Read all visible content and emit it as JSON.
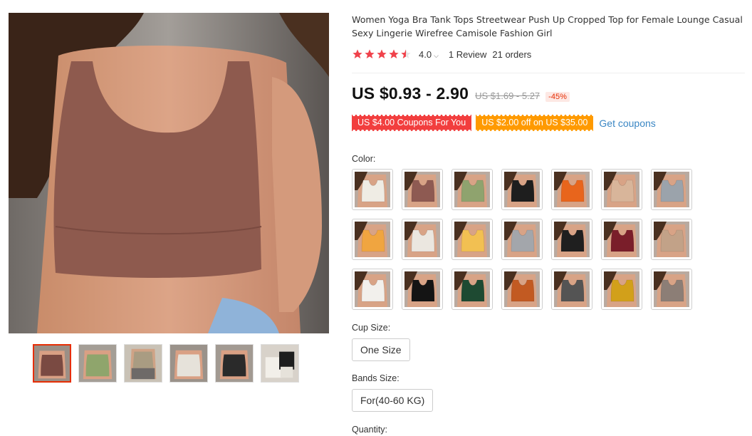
{
  "product": {
    "title": "Women Yoga Bra Tank Tops Streetwear Push Up Cropped Top for Female Lounge Casual Sexy Lingerie Wirefree Camisole Fashion Girl",
    "rating": "4.0",
    "rating_stars": 4.5,
    "reviews": "1 Review",
    "orders": "21 orders",
    "price": "US $0.93 - 2.90",
    "old_price": "US $1.69 - 5.27",
    "discount": "-45%"
  },
  "coupons": {
    "coupon1": "US $4.00 Coupons For You",
    "coupon2": "US $2.00 off on US $35.00",
    "get_coupons": "Get coupons"
  },
  "options": {
    "color_label": "Color:",
    "cup_label": "Cup Size:",
    "cup_value": "One Size",
    "bands_label": "Bands Size:",
    "bands_value": "For(40-60 KG)",
    "quantity_label": "Quantity:"
  },
  "gallery": {
    "main_color": "#8e5a4e",
    "thumb_colors": [
      "#7a4a42",
      "#8fa56c",
      "#a99c82",
      "#e6e2da",
      "#2a2a2a",
      "#e6e2da"
    ]
  },
  "swatch_colors": [
    "#efece4",
    "#8e5a52",
    "#8fa36e",
    "#1e1e1e",
    "#e8651c",
    "#d8b59a",
    "#9ba3ab",
    "#f0a540",
    "#ebe7e0",
    "#f2c052",
    "#a3a6ab",
    "#1f1f1f",
    "#7a1e2a",
    "#c2a288",
    "#f2f0ec",
    "#141414",
    "#1e4a32",
    "#c25a22",
    "#545454",
    "#d2a01a",
    "#8c7e76"
  ]
}
